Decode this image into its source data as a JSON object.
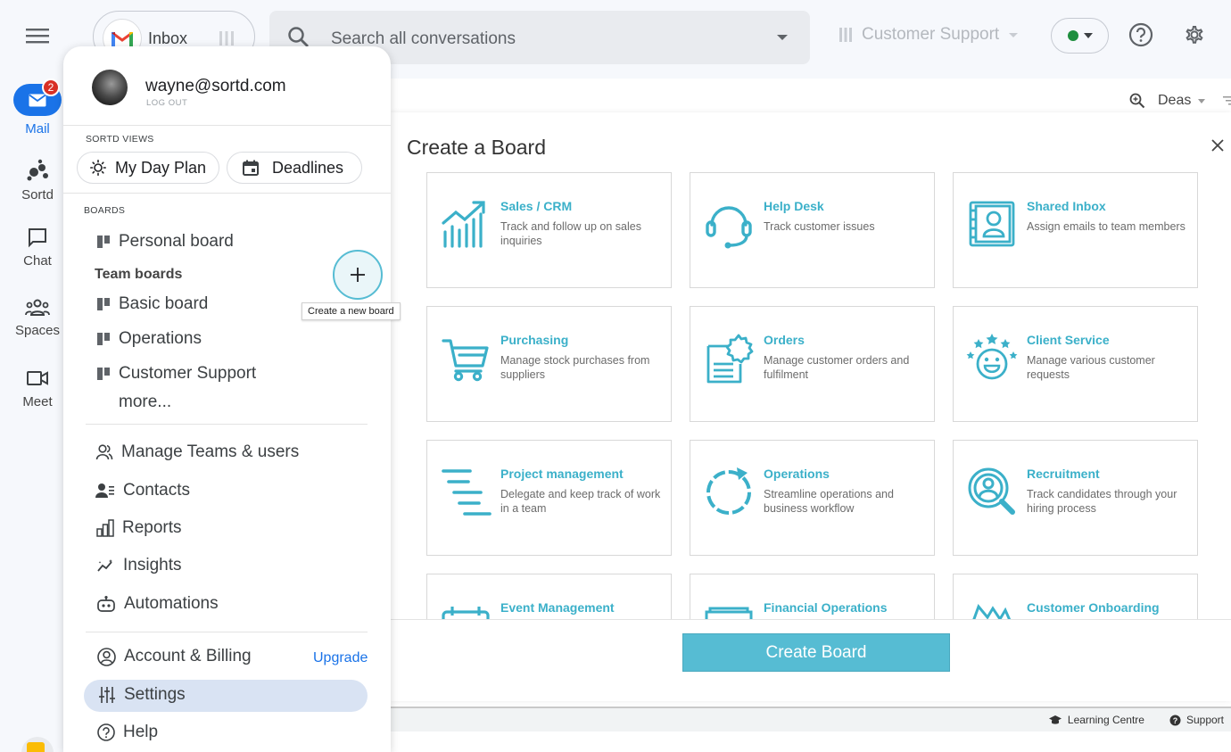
{
  "topbar": {
    "inbox_label": "Inbox",
    "search_placeholder": "Search all conversations",
    "board_select": "Customer Support",
    "status_color": "#1e8e3e"
  },
  "rail": {
    "mail": "Mail",
    "mail_badge": "2",
    "sortd": "Sortd",
    "chat": "Chat",
    "spaces": "Spaces",
    "meet": "Meet"
  },
  "background": {
    "header_label": "Deas",
    "footer_learning": "Learning Centre",
    "footer_support": "Support"
  },
  "panel": {
    "email": "wayne@sortd.com",
    "logout": "LOG OUT",
    "views_label": "SORTD VIEWS",
    "my_day_plan": "My Day Plan",
    "deadlines": "Deadlines",
    "boards_label": "BOARDS",
    "personal_board": "Personal board",
    "team_boards": "Team boards",
    "team_boards_list": [
      "Basic board",
      "Operations",
      "Customer Support"
    ],
    "more": "more...",
    "tooltip": "Create a new board",
    "menu": [
      "Manage Teams & users",
      "Contacts",
      "Reports",
      "Insights",
      "Automations"
    ],
    "account_billing": "Account & Billing",
    "upgrade": "Upgrade",
    "settings": "Settings",
    "help": "Help"
  },
  "modal": {
    "title": "Create a Board",
    "create_button": "Create Board",
    "accent_color": "#3bb0c9",
    "templates": [
      {
        "title": "Sales / CRM",
        "desc": "Track and follow up on sales inquiries",
        "icon": "chart-growth-icon"
      },
      {
        "title": "Help Desk",
        "desc": "Track customer issues",
        "icon": "headset-icon"
      },
      {
        "title": "Shared Inbox",
        "desc": "Assign emails to team members",
        "icon": "contact-card-icon"
      },
      {
        "title": "Purchasing",
        "desc": "Manage stock purchases from suppliers",
        "icon": "cart-icon"
      },
      {
        "title": "Orders",
        "desc": "Manage customer orders and fulfilment",
        "icon": "order-document-icon"
      },
      {
        "title": "Client Service",
        "desc": "Manage various customer requests",
        "icon": "happy-stars-icon"
      },
      {
        "title": "Project management",
        "desc": "Delegate and keep track of work in a team",
        "icon": "project-lines-icon"
      },
      {
        "title": "Operations",
        "desc": "Streamline operations and business workflow",
        "icon": "cycle-icon"
      },
      {
        "title": "Recruitment",
        "desc": "Track candidates through your hiring process",
        "icon": "candidate-search-icon"
      },
      {
        "title": "Event Management",
        "desc": "",
        "icon": "calendar-icon"
      },
      {
        "title": "Financial Operations",
        "desc": "",
        "icon": "finance-icon"
      },
      {
        "title": "Customer Onboarding",
        "desc": "",
        "icon": "handshake-icon"
      }
    ]
  }
}
